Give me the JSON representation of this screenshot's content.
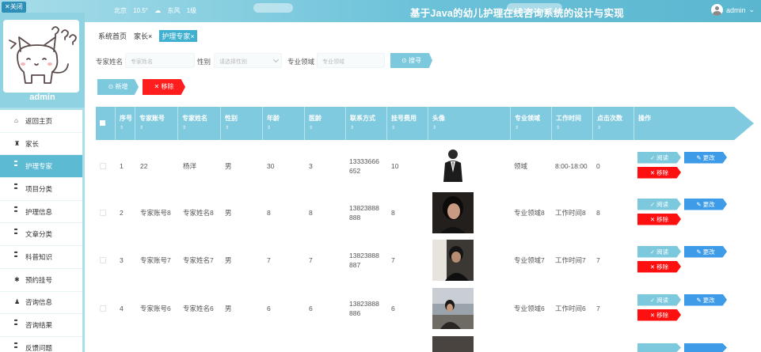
{
  "topbar": {
    "close_label": "✕关闭",
    "city": "北京",
    "temp": "10.5°",
    "wind_dir": "东风",
    "wind_level": "1级",
    "title": "基于Java的幼儿护理在线咨询系统的设计与实现",
    "user_name": "admin",
    "user_caret": "⌄"
  },
  "sidebar": {
    "username": "admin",
    "items": [
      {
        "label": "返回主页",
        "icon": "home-icon",
        "active": false
      },
      {
        "label": "家长",
        "icon": "user-icon",
        "active": false
      },
      {
        "label": "护理专家",
        "icon": "grid-icon",
        "active": true
      },
      {
        "label": "项目分类",
        "icon": "grid-icon",
        "active": false
      },
      {
        "label": "护理信息",
        "icon": "grid-icon",
        "active": false
      },
      {
        "label": "文章分类",
        "icon": "grid-icon",
        "active": false
      },
      {
        "label": "科普知识",
        "icon": "grid-icon",
        "active": false
      },
      {
        "label": "预约挂号",
        "icon": "grid-icon",
        "active": false
      },
      {
        "label": "咨询信息",
        "icon": "person-icon",
        "active": false
      },
      {
        "label": "咨询结果",
        "icon": "grid-icon",
        "active": false
      },
      {
        "label": "反馈问题",
        "icon": "grid-icon",
        "active": false
      }
    ]
  },
  "breadcrumb": {
    "home": "系统首页",
    "parent": "家长",
    "parent_close": "×",
    "current": "护理专家",
    "current_close": "×"
  },
  "search": {
    "name_label": "专家姓名",
    "name_placeholder": "专家姓名",
    "gender_label": "性别",
    "gender_placeholder": "请选择性别",
    "field_label": "专业领域",
    "field_placeholder": "专业领域",
    "button": "⊙ 搜寻"
  },
  "actions": {
    "add": "⊙ 新增",
    "remove": "✕ 移除"
  },
  "table": {
    "headers": [
      "序号",
      "专家账号",
      "专家姓名",
      "性别",
      "年龄",
      "医龄",
      "联系方式",
      "挂号费用",
      "头像",
      "专业领域",
      "工作时间",
      "点击次数",
      "操作"
    ],
    "sort_mark": "⇕",
    "rows": [
      {
        "idx": "1",
        "account": "22",
        "name": "杨洋",
        "gender": "男",
        "age": "30",
        "years": "3",
        "phone_a": "13333666",
        "phone_b": "652",
        "fee": "10",
        "field": "领域",
        "time": "8:00-18:00",
        "clicks": "0"
      },
      {
        "idx": "2",
        "account": "专家账号8",
        "name": "专家姓名8",
        "gender": "男",
        "age": "8",
        "years": "8",
        "phone_a": "13823888",
        "phone_b": "888",
        "fee": "8",
        "field": "专业领域8",
        "time": "工作时间8",
        "clicks": "8"
      },
      {
        "idx": "3",
        "account": "专家账号7",
        "name": "专家姓名7",
        "gender": "男",
        "age": "7",
        "years": "7",
        "phone_a": "13823888",
        "phone_b": "887",
        "fee": "7",
        "field": "专业领域7",
        "time": "工作时间7",
        "clicks": "7"
      },
      {
        "idx": "4",
        "account": "专家账号6",
        "name": "专家姓名6",
        "gender": "男",
        "age": "6",
        "years": "6",
        "phone_a": "13823888",
        "phone_b": "886",
        "fee": "6",
        "field": "专业领域6",
        "time": "工作时间6",
        "clicks": "7"
      }
    ],
    "row_actions": {
      "read": "✓ 阅读",
      "edit": "✎ 更改",
      "delete": "✕ 移除"
    }
  },
  "colors": {
    "accent": "#7cc9de",
    "danger": "#ff1010",
    "edit": "#3d9be8",
    "sidebar": "#a9dfe9"
  }
}
